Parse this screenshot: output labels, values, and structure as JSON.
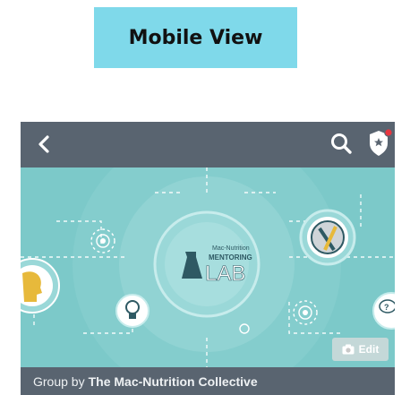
{
  "label": {
    "text": "Mobile View"
  },
  "navbar": {
    "back_icon": "chevron-left-icon",
    "search_icon": "search-icon",
    "shield_icon": "shield-star-icon"
  },
  "banner": {
    "logo_top": "Mac-Nutrition",
    "logo_middle": "MENTORING",
    "logo_bottom": "LAB",
    "edit_label": "Edit"
  },
  "group": {
    "prefix": "Group by",
    "name": "The Mac-Nutrition Collective"
  },
  "colors": {
    "label_bg": "#7fd9ea",
    "navbar_bg": "#596470",
    "banner_bg": "#7cc9c9",
    "notification_dot": "#e8363f"
  }
}
